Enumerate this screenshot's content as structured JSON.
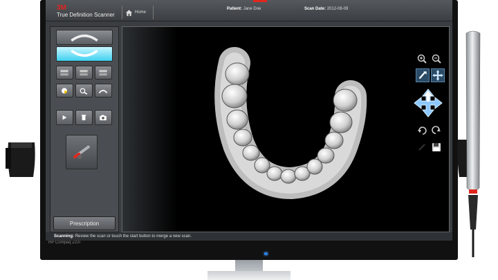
{
  "header": {
    "logo": "3M",
    "app_title": "True Definition Scanner",
    "home_label": "Home",
    "patient_label": "Patient:",
    "patient_name": "Jane Doe",
    "scan_date_label": "Scan Date:",
    "scan_date": "2012-08-09"
  },
  "left_panel": {
    "tools": [
      {
        "icon": "upper-arch-icon",
        "active": false
      },
      {
        "icon": "lower-arch-icon",
        "active": true
      },
      {
        "icon": "bite-left-icon",
        "active": false
      },
      {
        "icon": "bite-center-icon",
        "active": false
      },
      {
        "icon": "bite-right-icon",
        "active": false
      },
      {
        "icon": "tooth-select-icon",
        "active": false
      },
      {
        "icon": "tools-icon",
        "active": false
      },
      {
        "icon": "arch-view-icon",
        "active": false
      },
      {
        "icon": "play-icon",
        "active": false
      },
      {
        "icon": "delete-icon",
        "active": false
      },
      {
        "icon": "camera-icon",
        "active": false
      },
      {
        "icon": "wand-preview-icon",
        "active": false
      }
    ],
    "prescription_label": "Prescription"
  },
  "right_toolbar": {
    "tools": [
      "zoom-in-icon",
      "zoom-out-icon",
      "pan-tool-icon",
      "fit-view-icon",
      "rotate-move-icon",
      "rotate-icon",
      "reset-view-icon",
      "disabled-tool-icon",
      "save-icon"
    ]
  },
  "status": {
    "label": "Scanning:",
    "message": "Review the scan or touch the start button to merge a new scan."
  },
  "monitor": {
    "model": "HP Compaq Z22i"
  },
  "colors": {
    "brand_red": "#e0261f",
    "active_tool": "#3fd1f0",
    "viewport_bg": "#000000"
  }
}
